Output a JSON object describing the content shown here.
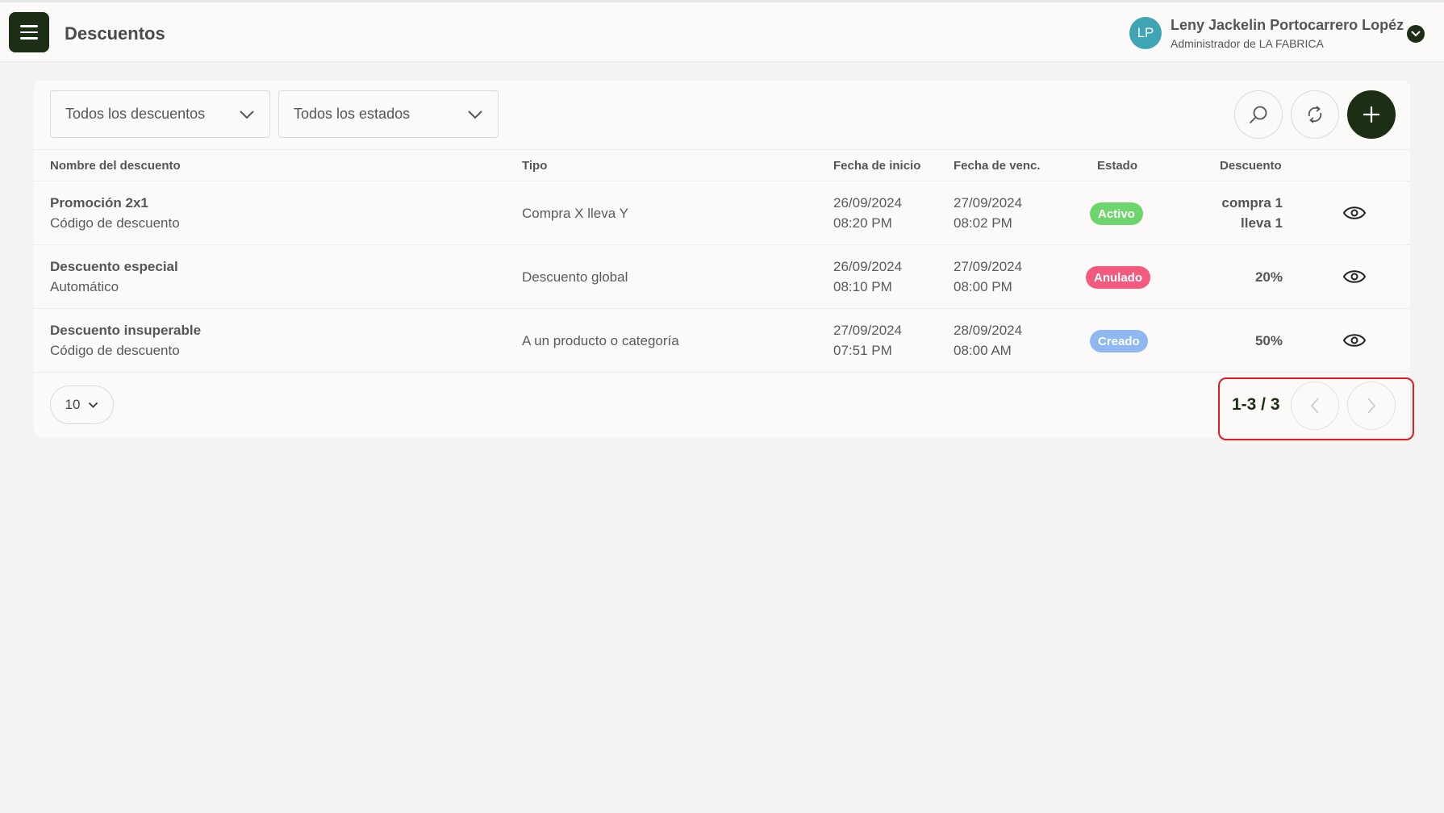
{
  "header": {
    "title": "Descuentos",
    "user_initials": "LP",
    "user_name": "Leny Jackelin Portocarrero Lopéz",
    "user_role": "Administrador de LA FABRICA"
  },
  "filters": {
    "discount_type": "Todos los descuentos",
    "status": "Todos los estados"
  },
  "table": {
    "headers": [
      "Nombre del descuento",
      "Tipo",
      "Fecha de inicio",
      "Fecha de venc.",
      "Estado",
      "Descuento"
    ],
    "rows": [
      {
        "name": "Promoción 2x1",
        "subtitle": "Código de descuento",
        "type": "Compra X lleva Y",
        "start_date": "26/09/2024",
        "start_time": "08:20 PM",
        "end_date": "27/09/2024",
        "end_time": "08:02 PM",
        "status": "Activo",
        "status_color": "#6dd46e",
        "discount_line1": "compra 1",
        "discount_line2": "lleva 1"
      },
      {
        "name": "Descuento especial",
        "subtitle": "Automático",
        "type": "Descuento global",
        "start_date": "26/09/2024",
        "start_time": "08:10 PM",
        "end_date": "27/09/2024",
        "end_time": "08:00 PM",
        "status": "Anulado",
        "status_color": "#f25b7e",
        "discount_line1": "20%",
        "discount_line2": ""
      },
      {
        "name": "Descuento insuperable",
        "subtitle": "Código de descuento",
        "type": "A un producto o categoría",
        "start_date": "27/09/2024",
        "start_time": "07:51 PM",
        "end_date": "28/09/2024",
        "end_time": "08:00 AM",
        "status": "Creado",
        "status_color": "#8fb8f2",
        "discount_line1": "50%",
        "discount_line2": ""
      }
    ]
  },
  "pagination": {
    "per_page": "10",
    "range": "1-3 / 3"
  },
  "icons": {
    "menu": "hamburger-icon",
    "user_dropdown": "chevron-down-icon",
    "search": "search-icon",
    "refresh": "refresh-icon",
    "add": "plus-icon",
    "view": "eye-icon",
    "prev": "chevron-left-icon",
    "next": "chevron-right-icon"
  },
  "colors": {
    "brand_dark": "#1c2f14",
    "avatar": "#3fa4b3",
    "highlight_border": "#e01b24"
  }
}
